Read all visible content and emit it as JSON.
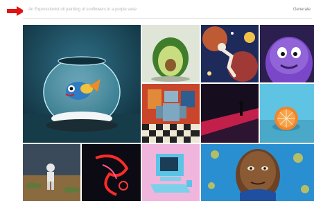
{
  "prompt": {
    "placeholder": "An Expressionist oil painting of sunflowers in a purple vase"
  },
  "actions": {
    "generate_label": "Generate"
  },
  "arrow_icon": "red-arrow-icon",
  "colors": {
    "arrow": "#e01414",
    "background": "#ffffff"
  },
  "gallery": {
    "tiles": [
      {
        "name": "tile-fishbowl"
      },
      {
        "name": "tile-avocado-chair"
      },
      {
        "name": "tile-astronaut-space"
      },
      {
        "name": "tile-purple-monster"
      },
      {
        "name": "tile-robot-chess"
      },
      {
        "name": "tile-dark-figure"
      },
      {
        "name": "tile-orange-half"
      },
      {
        "name": "tile-desert-astronaut"
      },
      {
        "name": "tile-neon-face"
      },
      {
        "name": "tile-retro-computer"
      },
      {
        "name": "tile-portrait-painting"
      }
    ]
  }
}
